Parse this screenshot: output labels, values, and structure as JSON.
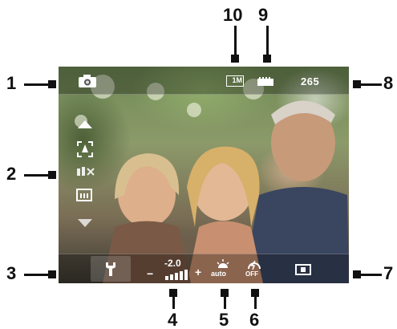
{
  "callouts": {
    "c1": "1",
    "c2": "2",
    "c3": "3",
    "c4": "4",
    "c5": "5",
    "c6": "6",
    "c7": "7",
    "c8": "8",
    "c9": "9",
    "c10": "10"
  },
  "osd": {
    "remaining_shots": "265",
    "resolution_badge": "1M",
    "ev_value": "-2.0",
    "ev_minus": "−",
    "ev_plus": "+",
    "wb_label": "auto",
    "flash_label": "OFF"
  },
  "icons": {
    "mode": "camera-icon",
    "resolution": "resolution-1m-icon",
    "memory": "memory-card-icon",
    "scroll_up": "arrow-up-icon",
    "scene": "scene-mode-icon",
    "iso": "iso-icon",
    "quality": "quality-icon",
    "scroll_down": "arrow-down-icon",
    "settings": "wrench-icon",
    "ev": "exposure-icon",
    "white_balance": "white-balance-auto-icon",
    "flash": "flash-off-icon",
    "metering": "metering-icon"
  }
}
